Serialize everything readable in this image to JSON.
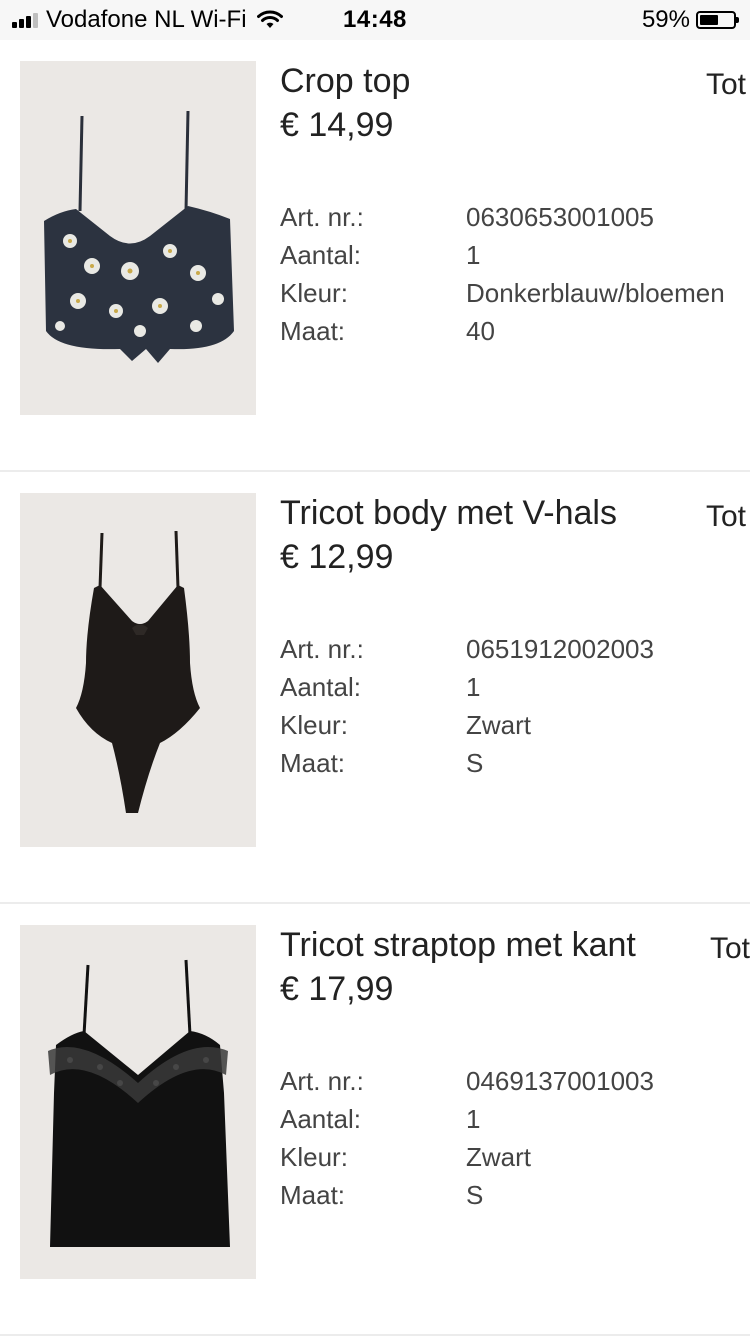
{
  "status_bar": {
    "carrier": "Vodafone NL Wi-Fi",
    "time": "14:48",
    "battery": "59%",
    "battery_level": 0.59
  },
  "items": [
    {
      "title": "Crop top",
      "price": "€ 14,99",
      "total_label": "Tot",
      "article_label": "Art. nr.:",
      "article": "0630653001005",
      "qty_label": "Aantal:",
      "qty": "1",
      "color_label": "Kleur:",
      "color": "Donkerblauw/bloemen",
      "size_label": "Maat:",
      "size": "40"
    },
    {
      "title": "Tricot body met V-hals",
      "price": "€ 12,99",
      "total_label": "Tot",
      "article_label": "Art. nr.:",
      "article": "0651912002003",
      "qty_label": "Aantal:",
      "qty": "1",
      "color_label": "Kleur:",
      "color": "Zwart",
      "size_label": "Maat:",
      "size": "S"
    },
    {
      "title": "Tricot straptop met kant",
      "price": "€ 17,99",
      "total_label": "Tot",
      "article_label": "Art. nr.:",
      "article": "0469137001003",
      "qty_label": "Aantal:",
      "qty": "1",
      "color_label": "Kleur:",
      "color": "Zwart",
      "size_label": "Maat:",
      "size": "S"
    }
  ]
}
